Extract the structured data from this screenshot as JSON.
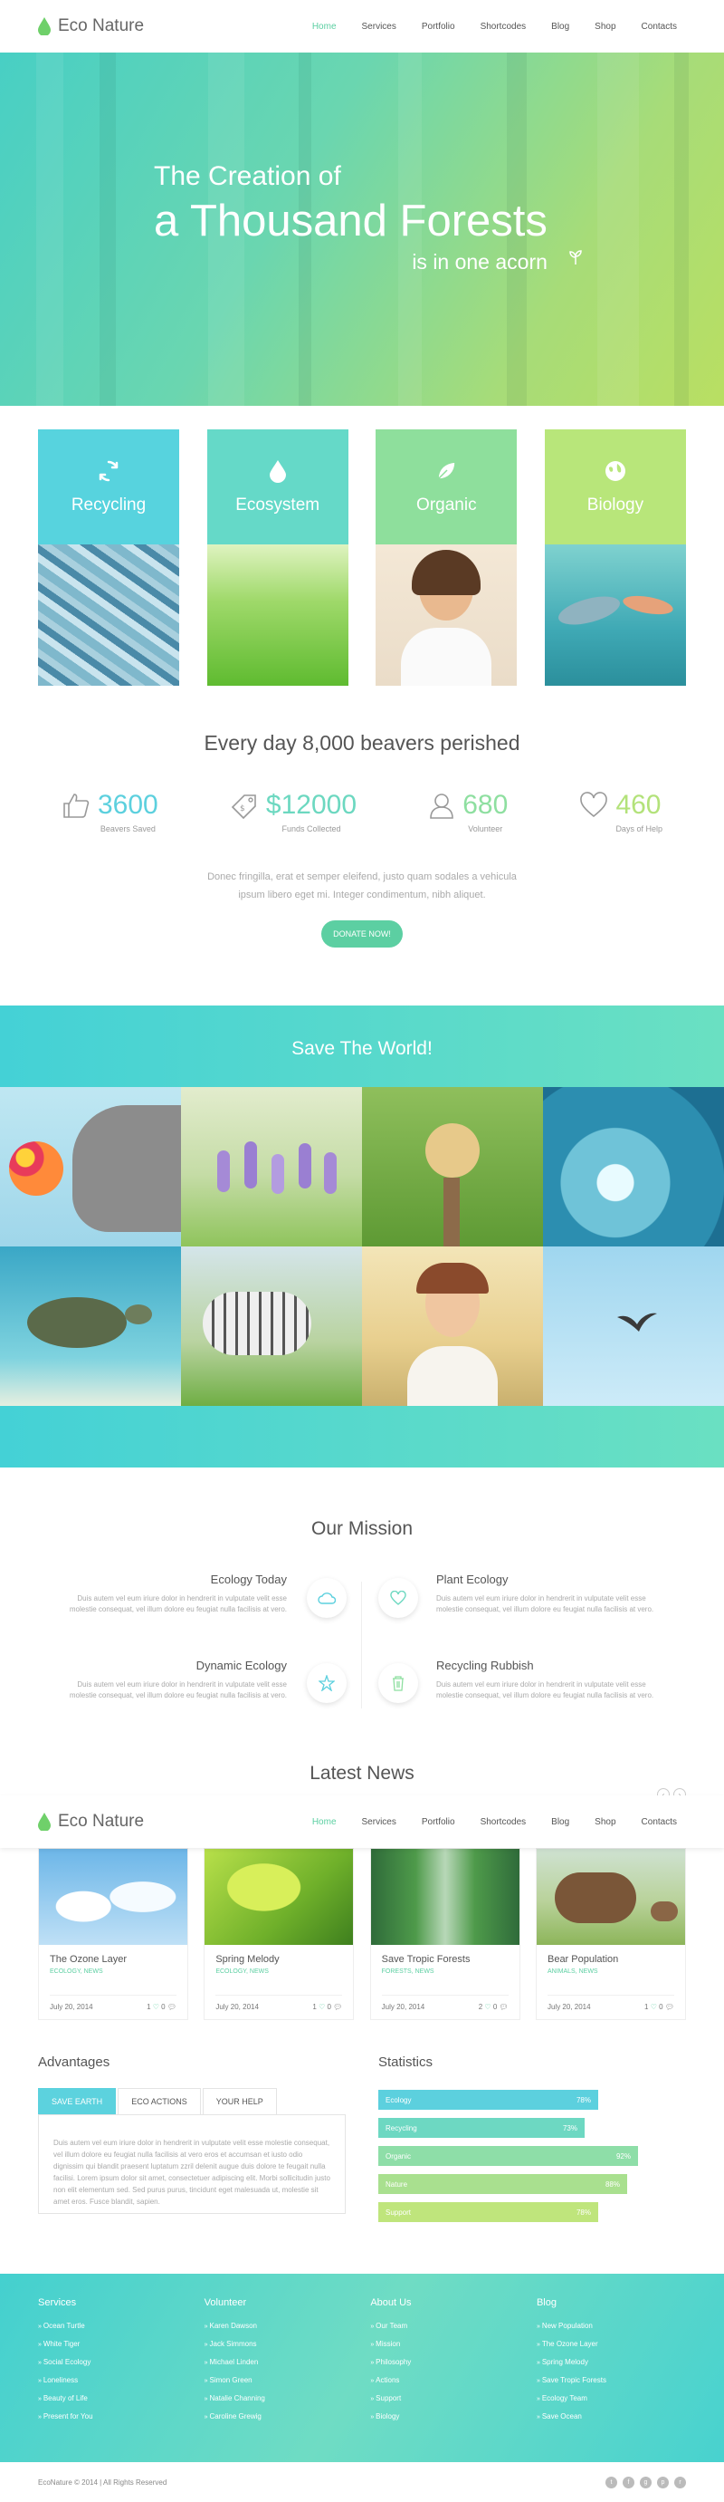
{
  "header": {
    "logo": "Eco Nature",
    "nav": [
      "Home",
      "Services",
      "Portfolio",
      "Shortcodes",
      "Blog",
      "Shop",
      "Contacts"
    ],
    "active": "Home"
  },
  "hero": {
    "line1": "The Creation of",
    "line2": "a Thousand Forests",
    "line3": "is in one acorn"
  },
  "features": [
    {
      "title": "Recycling",
      "icon": "recycle-icon",
      "color": "#57d3de"
    },
    {
      "title": "Ecosystem",
      "icon": "drop-icon",
      "color": "#65d9c8"
    },
    {
      "title": "Organic",
      "icon": "leaf-icon",
      "color": "#8edf9c"
    },
    {
      "title": "Biology",
      "icon": "globe-icon",
      "color": "#b8e67a"
    }
  ],
  "beavers": {
    "title": "Every day 8,000 beavers perished",
    "stats": [
      {
        "value": "3600",
        "label": "Beavers Saved",
        "color": "#5cd0de",
        "icon": "thumbs-up-icon"
      },
      {
        "value": "$12000",
        "label": "Funds Collected",
        "color": "#6cd8c0",
        "icon": "tag-icon"
      },
      {
        "value": "680",
        "label": "Volunteer",
        "color": "#8edfa0",
        "icon": "user-icon"
      },
      {
        "value": "460",
        "label": "Days of Help",
        "color": "#b3e27a",
        "icon": "heart-icon"
      }
    ],
    "text1": "Donec fringilla, erat et semper eleifend, justo quam sodales a vehicula",
    "text2": "ipsum libero eget mi. Integer condimentum, nibh aliquet.",
    "button": "DONATE NOW!"
  },
  "save": {
    "title": "Save The World!"
  },
  "mission": {
    "title": "Our Mission",
    "items": [
      {
        "title": "Ecology Today",
        "icon": "cloud-icon",
        "text": "Duis autem vel eum iriure dolor in hendrerit in vulputate velit esse molestie consequat, vel illum dolore eu feugiat nulla facilisis at vero."
      },
      {
        "title": "Plant Ecology",
        "icon": "heart-icon",
        "text": "Duis autem vel eum iriure dolor in hendrerit in vulputate velit esse molestie consequat, vel illum dolore eu feugiat nulla facilisis at vero."
      },
      {
        "title": "Dynamic Ecology",
        "icon": "star-icon",
        "text": "Duis autem vel eum iriure dolor in hendrerit in vulputate velit esse molestie consequat, vel illum dolore eu feugiat nulla facilisis at vero."
      },
      {
        "title": "Recycling Rubbish",
        "icon": "trash-icon",
        "text": "Duis autem vel eum iriure dolor in hendrerit in vulputate velit esse molestie consequat, vel illum dolore eu feugiat nulla facilisis at vero."
      }
    ]
  },
  "news": {
    "title": "Latest News",
    "posts": [
      {
        "title": "The Ozone Layer",
        "cat": "ECOLOGY, NEWS",
        "date": "July 20, 2014",
        "likes": "1",
        "comments": "0"
      },
      {
        "title": "Spring Melody",
        "cat": "ECOLOGY, NEWS",
        "date": "July 20, 2014",
        "likes": "1",
        "comments": "0"
      },
      {
        "title": "Save Tropic Forests",
        "cat": "FORESTS, NEWS",
        "date": "July 20, 2014",
        "likes": "2",
        "comments": "0"
      },
      {
        "title": "Bear Population",
        "cat": "ANIMALS, NEWS",
        "date": "July 20, 2014",
        "likes": "1",
        "comments": "0"
      }
    ]
  },
  "advantages": {
    "title": "Advantages",
    "tabs": [
      "SAVE EARTH",
      "ECO ACTIONS",
      "YOUR HELP"
    ],
    "active": "SAVE EARTH",
    "text": "Duis autem vel eum iriure dolor in hendrerit in vulputate velit esse molestie consequat, vel illum dolore eu feugiat nulla facilisis at vero eros et accumsan et iusto odio dignissim qui blandit praesent luptatum zzril delenit augue duis dolore te feugait nulla facilisi. Lorem ipsum dolor sit amet, consectetuer adipiscing elit. Morbi sollicitudin justo non elit elementum sed. Sed purus purus, tincidunt eget malesuada ut, molestie sit amet eros. Fusce blandit, sapien."
  },
  "statistics": {
    "title": "Statistics",
    "bars": [
      {
        "label": "Ecology",
        "value": "78%",
        "pct": 0.78,
        "color": "#5cd0de"
      },
      {
        "label": "Recycling",
        "value": "73%",
        "pct": 0.73,
        "color": "#6dd8c2"
      },
      {
        "label": "Organic",
        "value": "92%",
        "pct": 0.92,
        "color": "#8edea8"
      },
      {
        "label": "Nature",
        "value": "88%",
        "pct": 0.88,
        "color": "#a9e08f"
      },
      {
        "label": "Support",
        "value": "78%",
        "pct": 0.78,
        "color": "#bfe57c"
      }
    ]
  },
  "footer": {
    "cols": [
      {
        "title": "Services",
        "links": [
          "Ocean Turtle",
          "White Tiger",
          "Social Ecology",
          "Loneliness",
          "Beauty of Life",
          "Present for You"
        ]
      },
      {
        "title": "Volunteer",
        "links": [
          "Karen Dawson",
          "Jack Simmons",
          "Michael Linden",
          "Simon Green",
          "Natalie Channing",
          "Caroline Grewig"
        ]
      },
      {
        "title": "About Us",
        "links": [
          "Our Team",
          "Mission",
          "Philosophy",
          "Actions",
          "Support",
          "Biology"
        ]
      },
      {
        "title": "Blog",
        "links": [
          "New Population",
          "The Ozone Layer",
          "Spring Melody",
          "Save Tropic Forests",
          "Ecology Team",
          "Save Ocean"
        ]
      }
    ],
    "copyright": "EcoNature © 2014 | All Rights Reserved",
    "social": [
      "twitter-icon",
      "facebook-icon",
      "google-plus-icon",
      "pinterest-icon",
      "rss-icon"
    ]
  }
}
